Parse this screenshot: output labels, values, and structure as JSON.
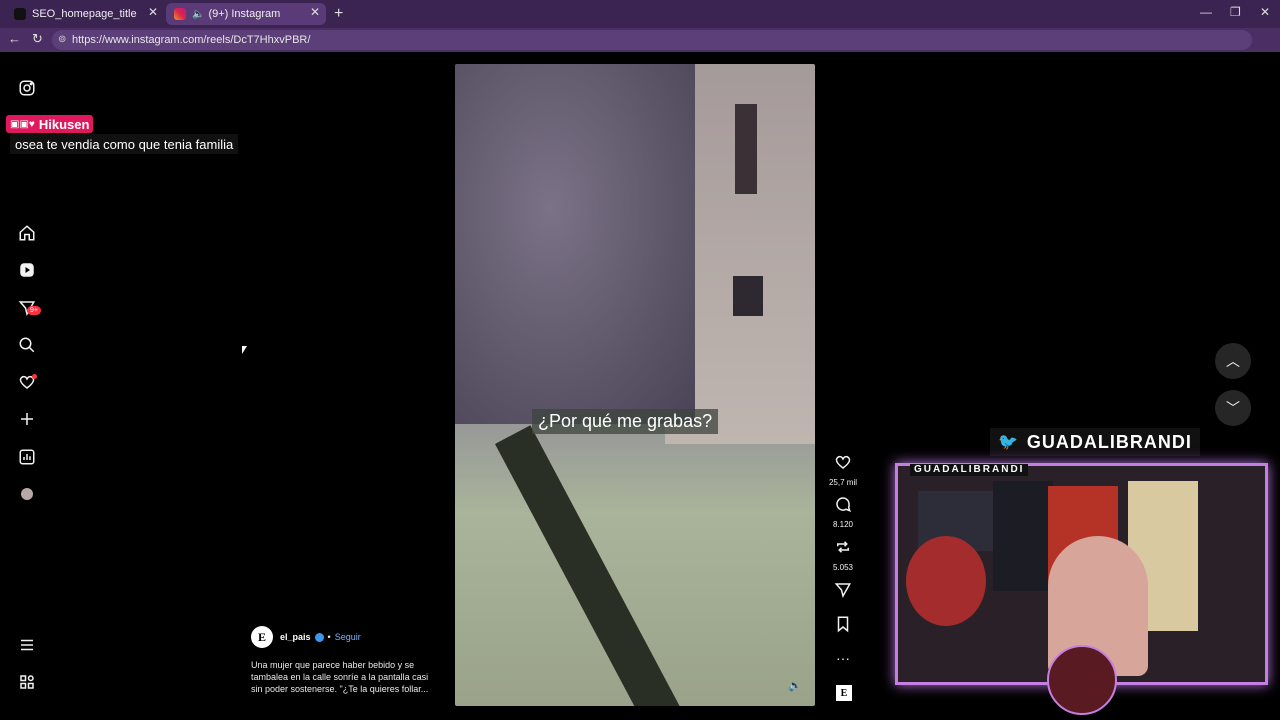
{
  "browser": {
    "tabs": [
      {
        "title": "SEO_homepage_title",
        "active": false,
        "favicon": "tiktok-icon"
      },
      {
        "title": "(9+) Instagram",
        "active": true,
        "favicon": "instagram-icon"
      }
    ],
    "url": "https://www.instagram.com/reels/DcT7HhxvPBR/"
  },
  "sidebar": {
    "items": [
      {
        "name": "instagram-logo"
      },
      {
        "name": "home"
      },
      {
        "name": "reels"
      },
      {
        "name": "messages",
        "badge": "9+"
      },
      {
        "name": "search"
      },
      {
        "name": "notifications"
      },
      {
        "name": "create"
      },
      {
        "name": "dashboard"
      },
      {
        "name": "profile"
      },
      {
        "name": "more"
      },
      {
        "name": "also-from-meta"
      }
    ]
  },
  "chat_overlay": {
    "username": "Hikusen",
    "message": "osea te vendia como que tenia familia"
  },
  "reel": {
    "subtitle": "¿Por qué me grabas?",
    "likes": "25,7 mil",
    "comments": "8.120",
    "reposts": "5.053",
    "author": {
      "name": "el_pais",
      "follow_label": "Seguir",
      "logo_letter": "E"
    },
    "caption": "Una mujer que parece haber bebido y se tambalea en la calle sonríe a la pantalla casi sin poder sostenerse. \"¿Te la quieres follar..."
  },
  "stream_overlay": {
    "twitter_handle": "GUADALIBRANDI",
    "cam_title": "GUADALIBRANDI"
  },
  "colors": {
    "browser_chrome": "#4b2e63",
    "badge": "#ff3040",
    "chat_name_bg": "#e0195f",
    "cam_border": "#c47fe0"
  }
}
